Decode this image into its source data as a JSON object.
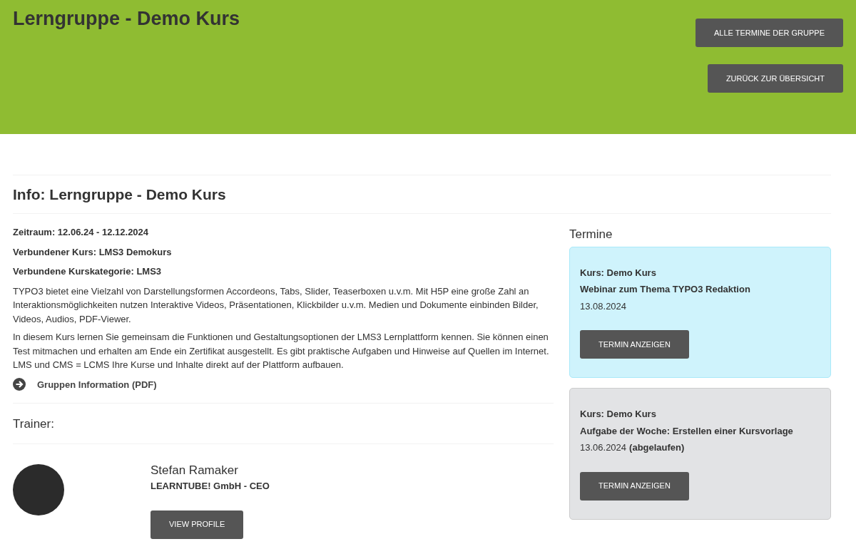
{
  "header": {
    "title": "Lerngruppe - Demo Kurs",
    "buttons": [
      "ALLE TERMINE DER GRUPPE",
      "ZURÜCK ZUR ÜBERSICHT"
    ]
  },
  "info": {
    "heading": "Info: Lerngruppe - Demo Kurs",
    "meta": [
      "Zeitraum: 12.06.24 - 12.12.2024",
      "Verbundener Kurs: LMS3 Demokurs",
      "Verbundene Kurskategorie: LMS3"
    ],
    "paragraphs": [
      "TYPO3 bietet eine Vielzahl von Darstellungsformen Accordeons, Tabs, Slider, Teaserboxen u.v.m. Mit H5P eine große Zahl an Interaktionsmöglichkeiten nutzen Interaktive Videos, Präsentationen, Klickbilder u.v.m. Medien und Dokumente einbinden Bilder, Videos, Audios, PDF-Viewer.",
      "In diesem Kurs lernen Sie gemeinsam die Funktionen und Gestaltungsoptionen der LMS3 Lernplattform kennen. Sie können einen Test mitmachen und erhalten am Ende ein Zertifikat ausgestellt. Es gibt praktische Aufgaben und Hinweise auf Quellen im Internet. LMS und CMS = LCMS Ihre Kurse und Inhalte direkt auf der Plattform aufbauen."
    ],
    "link": "Gruppen Information (PDF)"
  },
  "trainer": {
    "heading": "Trainer:",
    "name": "Stefan Ramaker",
    "role": "LEARNTUBE! GmbH - CEO",
    "button": "VIEW PROFILE"
  },
  "events": {
    "heading": "Termine",
    "items": [
      {
        "course": "Kurs: Demo Kurs",
        "title": "Webinar zum Thema TYPO3 Redaktion",
        "date": "13.08.2024",
        "expired": false,
        "button": "TERMIN ANZEIGEN"
      },
      {
        "course": "Kurs: Demo Kurs",
        "title": "Aufgabe der Woche: Erstellen einer Kursvorlage",
        "date": "13.06.2024",
        "expired": true,
        "status": "(abgelaufen)",
        "button": "TERMIN ANZEIGEN"
      }
    ]
  }
}
